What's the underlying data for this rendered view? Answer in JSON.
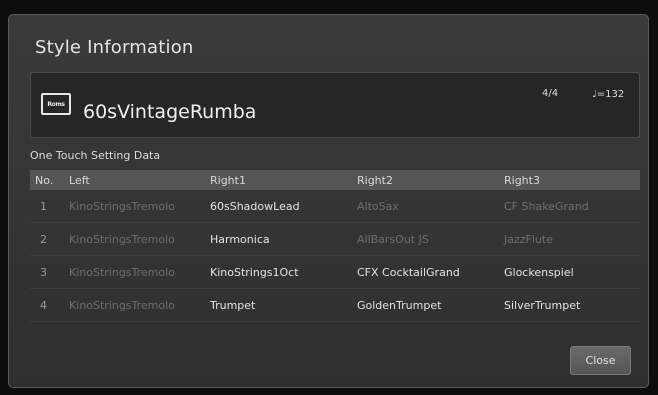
{
  "dialog": {
    "title": "Style Information",
    "style_icon_text": "Roms",
    "style_name": "60sVintageRumba",
    "time_signature": "4/4",
    "tempo": "♩=132",
    "section_label": "One Touch Setting Data",
    "columns": [
      "No.",
      "Left",
      "Right1",
      "Right2",
      "Right3"
    ],
    "rows": [
      {
        "no": "1",
        "left": "KinoStringsTremolo",
        "right1": "60sShadowLead",
        "right2": "AltoSax",
        "right3": "CF ShakeGrand"
      },
      {
        "no": "2",
        "left": "KinoStringsTremolo",
        "right1": "Harmonica",
        "right2": "AllBarsOut JS",
        "right3": "JazzFlute"
      },
      {
        "no": "3",
        "left": "KinoStringsTremolo",
        "right1": "KinoStrings1Oct",
        "right2": "CFX CocktailGrand",
        "right3": "Glockenspiel"
      },
      {
        "no": "4",
        "left": "KinoStringsTremolo",
        "right1": "Trumpet",
        "right2": "GoldenTrumpet",
        "right3": "SilverTrumpet"
      }
    ],
    "close_label": "Close",
    "colors": {
      "panel": "#333333",
      "header_row": "#555555",
      "text": "#e4e4e4",
      "dim_text": "#6e6e6e"
    }
  }
}
